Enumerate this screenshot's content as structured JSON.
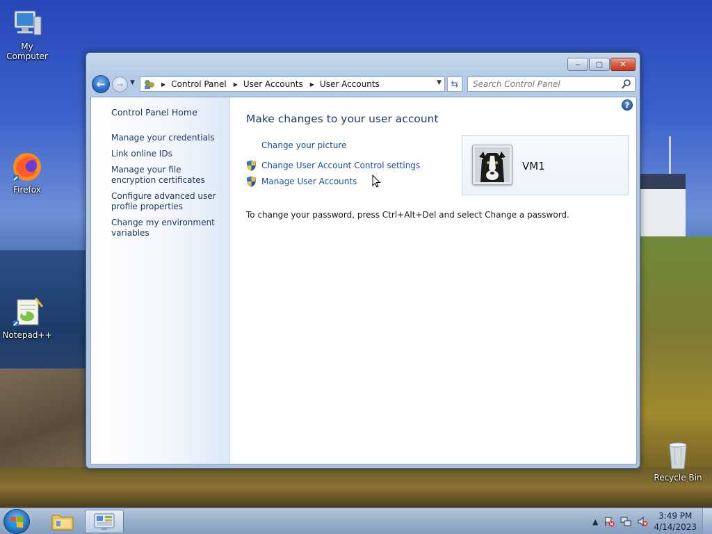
{
  "desktop": {
    "icons": [
      {
        "label": "My Computer",
        "icon": "computer-icon"
      },
      {
        "label": "Firefox",
        "icon": "firefox-icon"
      },
      {
        "label": "Notepad++",
        "icon": "notepad-plus-plus-icon"
      },
      {
        "label": "Recycle Bin",
        "icon": "recycle-bin-icon"
      }
    ]
  },
  "window": {
    "controls": {
      "minimize": "‒",
      "maximize": "▢",
      "close": "✕"
    },
    "address": {
      "crumbs": [
        "Control Panel",
        "User Accounts",
        "User Accounts"
      ]
    },
    "search": {
      "placeholder": "Search Control Panel"
    },
    "left_pane": {
      "home": "Control Panel Home",
      "links": [
        "Manage your credentials",
        "Link online IDs",
        "Manage your file encryption certificates",
        "Configure advanced user profile properties",
        "Change my environment variables"
      ]
    },
    "main": {
      "help": "?",
      "heading": "Make changes to your user account",
      "tasks": [
        {
          "label": "Change your picture",
          "shield": false
        },
        {
          "label": "Change User Account Control settings",
          "shield": true
        },
        {
          "label": "Manage User Accounts",
          "shield": true
        }
      ],
      "note": "To change your password, press Ctrl+Alt+Del and select Change a password.",
      "account": {
        "name": "VM1"
      }
    }
  },
  "taskbar": {
    "clock": {
      "time": "3:49 PM",
      "date": "4/14/2023"
    },
    "tray_arrow": "▲",
    "colors": {
      "accent": "#2a78c8"
    }
  }
}
